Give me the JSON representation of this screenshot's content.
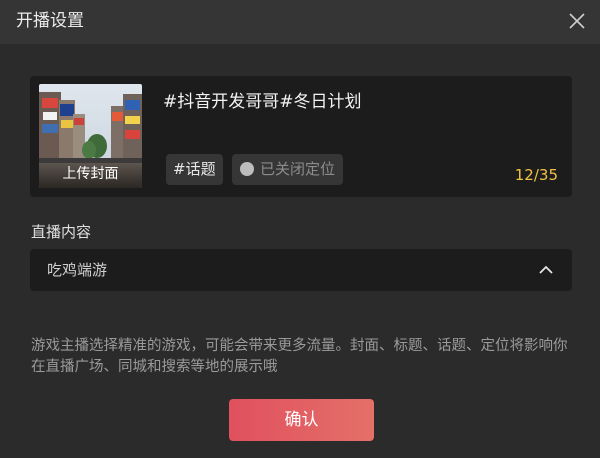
{
  "dialog": {
    "title": "开播设置",
    "close_icon": "close-icon"
  },
  "card": {
    "cover_label": "上传封面",
    "topic_title": "#抖音开发哥哥#冬日计划",
    "topic_chip": "#话题",
    "location_chip": "已关闭定位",
    "counter": "12/35",
    "counter_color": "#f0c346"
  },
  "content": {
    "label": "直播内容",
    "selected": "吃鸡端游",
    "chevron_icon": "chevron-up-icon"
  },
  "hint": "游戏主播选择精准的游戏，可能会带来更多流量。封面、标题、话题、定位将影响你在直播广场、同城和搜索等地的展示哦",
  "confirm_label": "确认",
  "colors": {
    "accent": "#e0505e",
    "background": "#2b2b2b",
    "panel": "#1c1c1c"
  }
}
